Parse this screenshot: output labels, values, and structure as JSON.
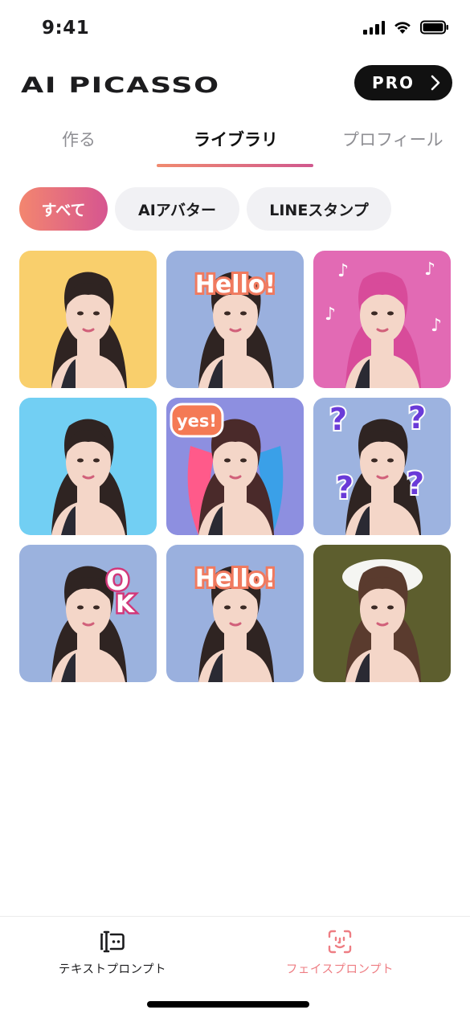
{
  "status_bar": {
    "time": "9:41",
    "icons": [
      "cellular-signal-icon",
      "wifi-icon",
      "battery-icon"
    ]
  },
  "header": {
    "app_title": "AI PICASSO",
    "pro_label": "PRO",
    "pro_icon": "chevron-right-icon"
  },
  "tabs": [
    {
      "label": "作る",
      "active": false
    },
    {
      "label": "ライブラリ",
      "active": true
    },
    {
      "label": "プロフィール",
      "active": false
    }
  ],
  "filters": [
    {
      "label": "すべて",
      "active": true
    },
    {
      "label": "AIアバター",
      "active": false
    },
    {
      "label": "LINEスタンプ",
      "active": false
    }
  ],
  "library": {
    "items": [
      {
        "background": "#f9cf6c",
        "sticker_text": ""
      },
      {
        "background": "#9ab0de",
        "sticker_text": "Hello!"
      },
      {
        "background": "#e26ab4",
        "sticker_text": "♪"
      },
      {
        "background": "#72cff3",
        "sticker_text": ""
      },
      {
        "background": "#8d8fe0",
        "sticker_text": "yes!"
      },
      {
        "background": "#9db3e0",
        "sticker_text": "?"
      },
      {
        "background": "#9bb2de",
        "sticker_text": "OK"
      },
      {
        "background": "#9ab0de",
        "sticker_text": "Hello!"
      },
      {
        "background": "#5d5e2e",
        "sticker_text": ""
      }
    ]
  },
  "bottom_nav": [
    {
      "label": "テキストプロンプト",
      "icon": "text-prompt-icon",
      "active": false
    },
    {
      "label": "フェイスプロンプト",
      "icon": "face-scan-icon",
      "active": true
    }
  ],
  "colors": {
    "accent_start": "#f3866f",
    "accent_end": "#d65590",
    "inactive_text": "#8e8e93",
    "chip_bg": "#f1f1f4"
  }
}
